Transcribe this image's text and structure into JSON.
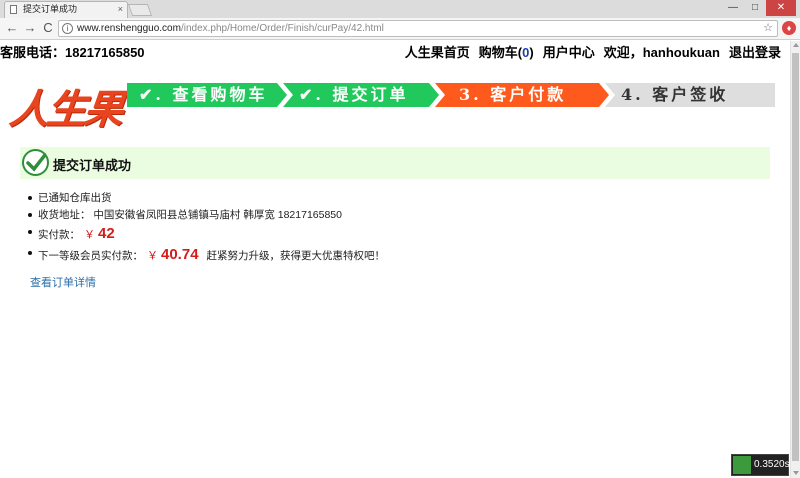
{
  "browser": {
    "tab_title": "提交订单成功",
    "tab_close": "×",
    "url_host": "www.renshengguo.com",
    "url_path": "/index.php/Home/Order/Finish/curPay/42.html",
    "back": "←",
    "forward": "→",
    "reload": "C",
    "star": "☆",
    "extension": "♦",
    "minimize": "—",
    "maximize": "□",
    "close": "✕",
    "info": "i"
  },
  "header": {
    "hotline": "客服电话：18217165850",
    "nav": {
      "home": "人生果首页",
      "cart_label": "购物车(",
      "cart_count": "0",
      "cart_close": ")",
      "user_center": "用户中心",
      "welcome": "欢迎，hanhoukuan",
      "logout": "退出登录"
    },
    "logo_text": "人生果"
  },
  "steps": [
    {
      "label": "✔. 查看购物车",
      "state": "done"
    },
    {
      "label": "✔. 提交订单",
      "state": "done"
    },
    {
      "label": "3. 客户付款",
      "state": "current"
    },
    {
      "label": "4. 客户签收",
      "state": "todo"
    }
  ],
  "success": {
    "title": "提交订单成功"
  },
  "info": {
    "notice": "已通知仓库出货",
    "address_label": "收货地址：",
    "address_value": "中国安徽省凤阳县总铺镇马庙村 韩厚宽 18217165850",
    "paid_label": "实付款：",
    "currency": "￥",
    "paid_amount": "42",
    "next_level_label": "下一等级会员实付款：",
    "next_level_amount": "40.74",
    "promo": "赶紧努力升级，获得更大优惠特权吧！"
  },
  "links": {
    "order_detail": "查看订单详情"
  },
  "badge": {
    "timer": "0.3520s"
  },
  "colors": {
    "step_done": "#21c85c",
    "step_current": "#ff5a1e",
    "step_todo": "#dedede",
    "price": "#d41c1c",
    "success_bg": "#eafde1",
    "link": "#2b6ea8"
  }
}
